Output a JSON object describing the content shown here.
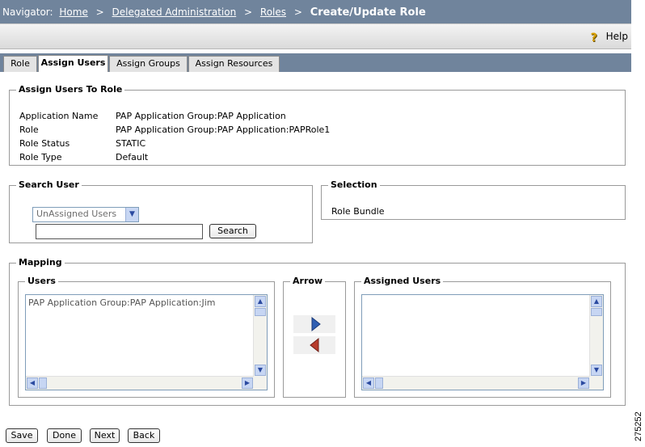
{
  "navigator": {
    "label": "Navigator:",
    "crumbs": [
      "Home",
      "Delegated Administration",
      "Roles"
    ],
    "separator": ">",
    "current": "Create/Update Role"
  },
  "help": {
    "label": "Help",
    "icon": "help-question-icon"
  },
  "tabs": [
    {
      "label": "Role"
    },
    {
      "label": "Assign Users"
    },
    {
      "label": "Assign Groups"
    },
    {
      "label": "Assign Resources"
    }
  ],
  "assign_users": {
    "legend": "Assign Users To Role",
    "rows": [
      {
        "label": "Application Name",
        "value": "PAP Application Group:PAP Application"
      },
      {
        "label": "Role",
        "value": "PAP Application Group:PAP Application:PAPRole1"
      },
      {
        "label": "Role Status",
        "value": "STATIC"
      },
      {
        "label": "Role Type",
        "value": "Default"
      }
    ]
  },
  "search_user": {
    "legend": "Search User",
    "filter_selected": "UnAssigned Users",
    "input_value": "",
    "search_label": "Search"
  },
  "selection": {
    "legend": "Selection",
    "value": "Role Bundle"
  },
  "mapping": {
    "legend": "Mapping",
    "users_legend": "Users",
    "users": [
      "PAP Application Group:PAP Application:Jim"
    ],
    "arrow_legend": "Arrow",
    "assigned_legend": "Assigned Users",
    "assigned": []
  },
  "footer": {
    "save": "Save",
    "done": "Done",
    "next": "Next",
    "back": "Back"
  },
  "figure_id": "275252",
  "colors": {
    "header": "#70849c",
    "arrow_right": "#2f5fb3",
    "arrow_left": "#b83c2c"
  }
}
